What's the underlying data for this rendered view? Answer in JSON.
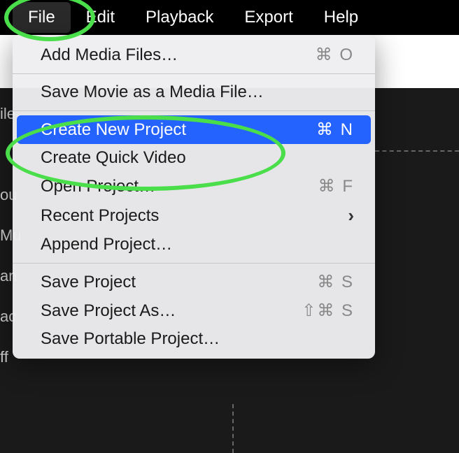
{
  "menubar": {
    "items": [
      {
        "label": "File",
        "active": true
      },
      {
        "label": "Edit",
        "active": false
      },
      {
        "label": "Playback",
        "active": false
      },
      {
        "label": "Export",
        "active": false
      },
      {
        "label": "Help",
        "active": false
      }
    ]
  },
  "dropdown": {
    "groups": [
      [
        {
          "label": "Add Media Files…",
          "shortcut": "⌘ O",
          "highlighted": false,
          "submenu": false
        }
      ],
      [
        {
          "label": "Save Movie as a Media File…",
          "shortcut": "",
          "highlighted": false,
          "submenu": false
        }
      ],
      [
        {
          "label": "Create New Project",
          "shortcut": "⌘ N",
          "highlighted": true,
          "submenu": false
        },
        {
          "label": "Create Quick Video",
          "shortcut": "",
          "highlighted": false,
          "submenu": false
        },
        {
          "label": "Open Project…",
          "shortcut": "⌘ F",
          "highlighted": false,
          "submenu": false
        },
        {
          "label": "Recent Projects",
          "shortcut": "",
          "highlighted": false,
          "submenu": true
        },
        {
          "label": "Append Project…",
          "shortcut": "",
          "highlighted": false,
          "submenu": false
        }
      ],
      [
        {
          "label": "Save Project",
          "shortcut": "⌘ S",
          "highlighted": false,
          "submenu": false
        },
        {
          "label": "Save Project As…",
          "shortcut": "⇧⌘ S",
          "highlighted": false,
          "submenu": false
        },
        {
          "label": "Save Portable Project…",
          "shortcut": "",
          "highlighted": false,
          "submenu": false
        }
      ]
    ]
  },
  "background": {
    "sidebar_partial_labels": [
      "ile",
      "ou",
      "Mu",
      "an",
      "ac",
      "ff"
    ]
  },
  "annotations": {
    "file_menu_circled": true,
    "create_new_project_circled": true
  }
}
